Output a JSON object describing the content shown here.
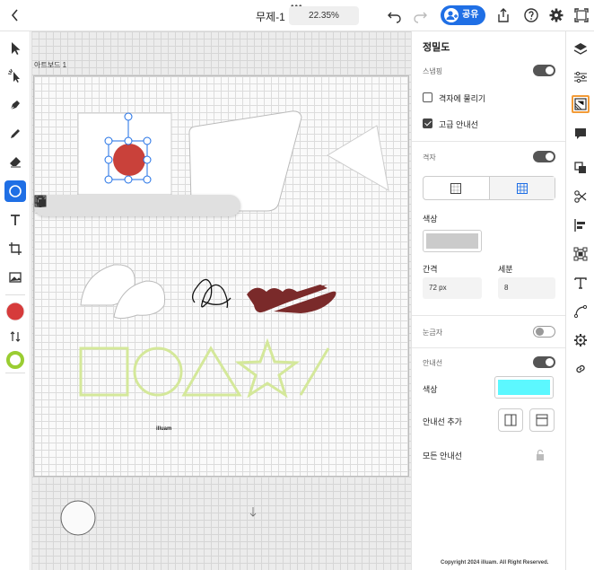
{
  "header": {
    "title": "무제-1",
    "zoom": "22.35%",
    "share_label": "공유",
    "more_dots": "•••"
  },
  "canvas": {
    "artboard_label": "아트보드 1",
    "watermark": "illuam"
  },
  "panel": {
    "title": "정밀도",
    "snapping_label": "스냅핑",
    "snap_to_grid_label": "격자에 물리기",
    "advanced_guides_label": "고급 안내선",
    "grid_label": "격자",
    "color_label": "색상",
    "spacing_label": "간격",
    "spacing_value": "72 px",
    "subdivision_label": "세분",
    "subdivision_value": "8",
    "ruler_label": "눈금자",
    "guides_label": "안내선",
    "guide_color_label": "색상",
    "add_guide_label": "안내선 추가",
    "all_guides_label": "모든 안내선",
    "snapping_on": true,
    "snap_to_grid_checked": false,
    "advanced_guides_checked": true,
    "grid_on": true,
    "ruler_on": false,
    "guides_on": true,
    "grid_color": "#cbcbcb",
    "guide_color": "#5cf8ff"
  },
  "footer": {
    "copyright": "Copyright 2024 illuam. All Right Reserved."
  },
  "colors": {
    "accent": "#1f6fe5",
    "fill_swatch": "#d63b3b",
    "stroke_swatch": "#9acd32",
    "selected_shape": "#c9413a",
    "maroon_shape": "#7a2a2a",
    "lime_outline": "#d4e89a",
    "rail_highlight": "#f29b38"
  },
  "icons": {
    "left_tools": [
      "select-icon",
      "direct-select-icon",
      "pen-icon",
      "pencil-icon",
      "eraser-icon",
      "ellipse-icon",
      "text-icon",
      "artboard-icon",
      "image-icon"
    ],
    "right_rail": [
      "layers-icon",
      "properties-icon",
      "precision-icon",
      "comments-icon",
      "combine-icon",
      "scissors-icon",
      "align-icon",
      "transform-icon",
      "type-icon",
      "path-icon",
      "settings-icon",
      "link-icon"
    ]
  }
}
